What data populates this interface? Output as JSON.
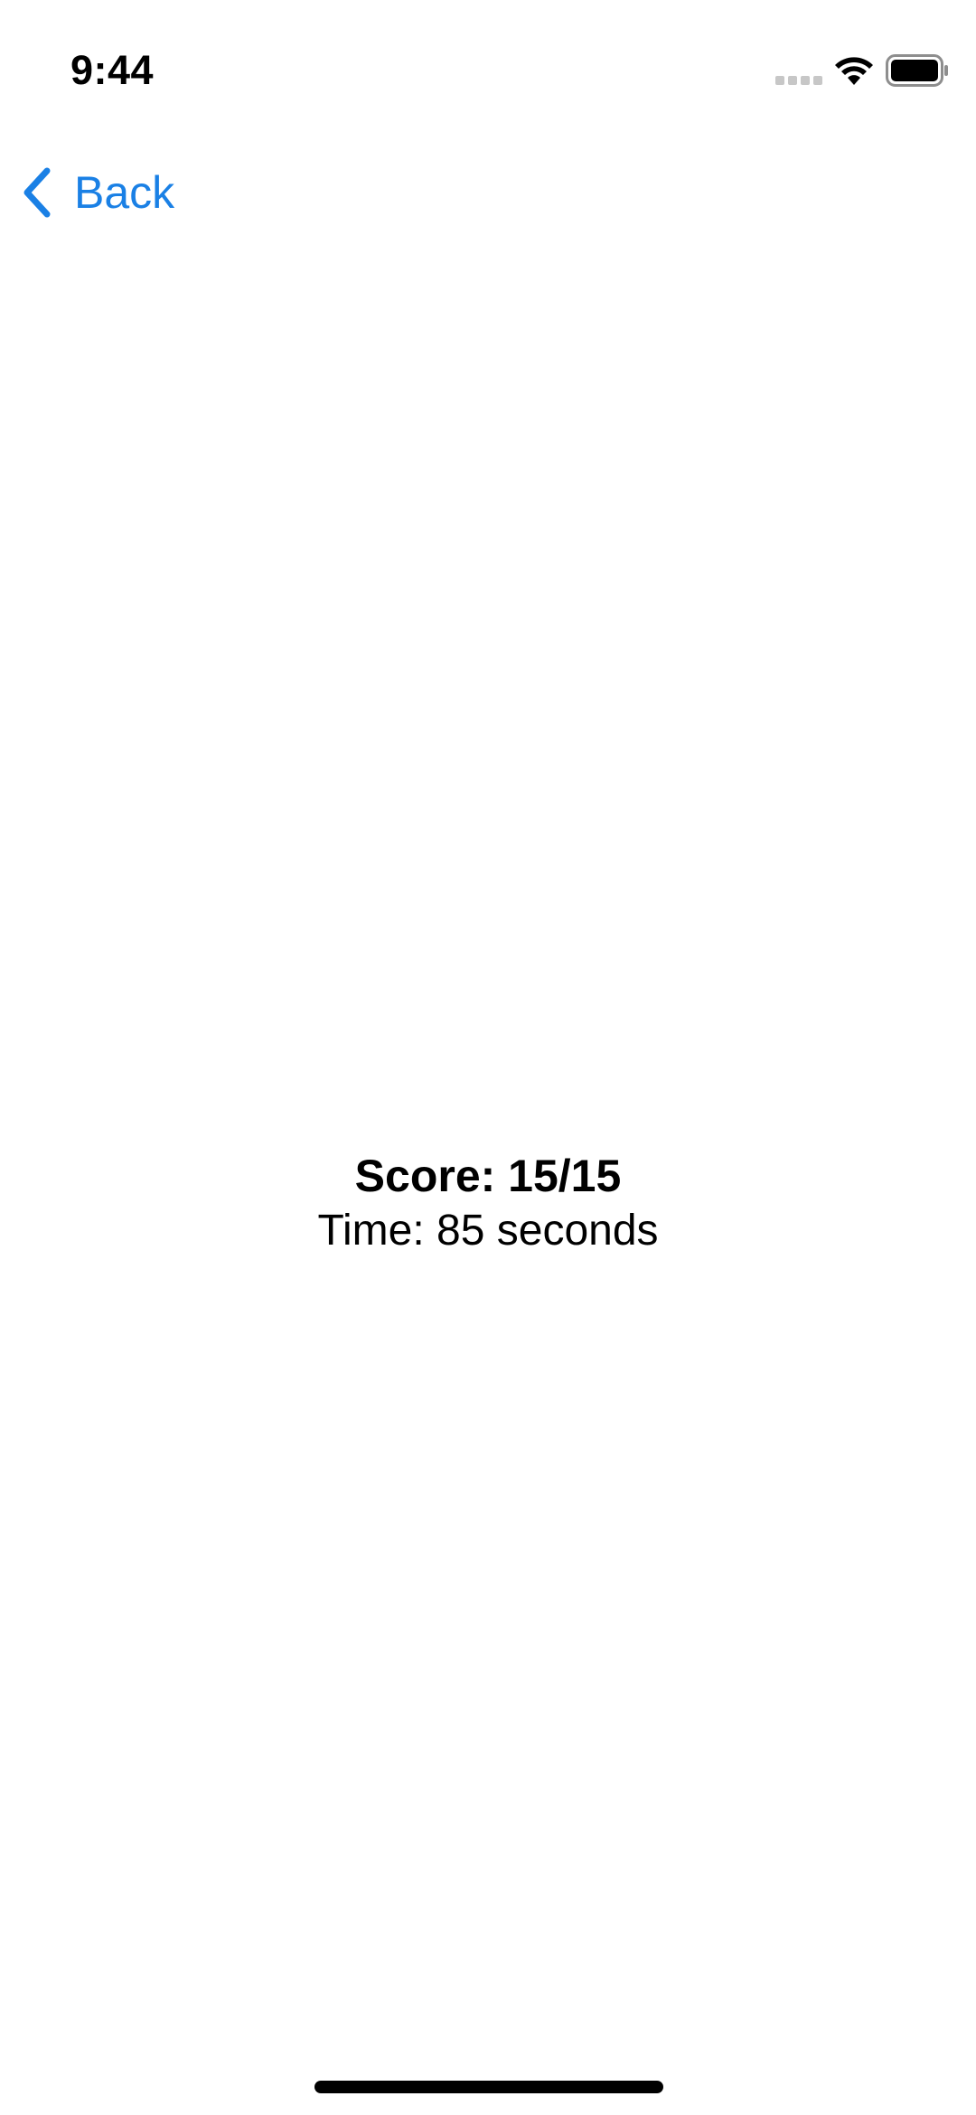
{
  "status_bar": {
    "time": "9:44",
    "icons": [
      "cellular-signal-icon",
      "wifi-icon",
      "battery-icon"
    ]
  },
  "nav": {
    "back_label": "Back",
    "back_icon": "chevron-left-icon",
    "accent_color": "#1a80e5"
  },
  "results": {
    "score": "Score: 15/15",
    "time": "Time: 85 seconds"
  }
}
